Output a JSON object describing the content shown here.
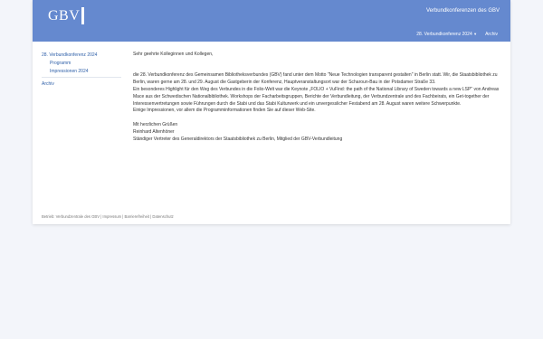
{
  "header": {
    "logo": "GBV",
    "site_title": "Verbundkonferenzen des GBV",
    "nav": [
      {
        "label": "28. Verbundkonferenz 2024"
      },
      {
        "label": "Archiv"
      }
    ]
  },
  "sidebar": {
    "items": [
      {
        "label": "28. Verbundkonferenz 2024"
      },
      {
        "label": "Programm"
      },
      {
        "label": "Impressionen 2024"
      },
      {
        "label": "Archiv"
      }
    ]
  },
  "content": {
    "greeting": "Sehr geehrte Kolleginnen und Kollegen,",
    "p1": "die 28. Verbundkonferenz des Gemeinsamen Bibliotheksverbundes (GBV) fand unter dem Motto \"Neue Technologien transparent gestalten\" in Berlin statt. Wir, die Staatsbibliothek zu Berlin, waren gerne am 28. und 29. August die Gastgeberin der Konferenz, Hauptveranstaltungsort war der Scharoun-Bau in der Potsdamer Straße 33.",
    "p2": "Ein besonderes Highlight für den Weg des Verbundes in die Folio-Welt war die Keynote „FOLIO + VuFind: the path of the National Library of Sweden towards a new LSP\" von Andreas Mace aus der Schwedischen Nationalbibliothek. Workshops der Facharbeitsgruppen, Berichte der Verbundleitung, der Verbundzentrale und des Fachbeirats, ein Get-together der Interessenvertretungen sowie Führungen durch die Stabi und das Stabi Kulturwerk und ein unvergesslicher Festabend am 28. August waren weitere Schwerpunkte.",
    "p3": "Einige Impressionen, vor allem die Programminformationen finden Sie auf dieser Web-Site.",
    "closing": "Mit herzlichen Grüßen",
    "name": "Reinhard Altenhöner",
    "role": "Ständiger Vertreter des Generaldirektors der Staatsbibliothek zu Berlin, Mitglied der GBV-Verbundleitung"
  },
  "footer": {
    "text": "Betrieb: Verbundzentrale des GBV | Impressum | Barrierefreiheit | Datenschutz"
  },
  "colors": {
    "header_bg": "#6589cf",
    "link": "#2e5fa8",
    "page_bg": "#f3f5fa"
  }
}
